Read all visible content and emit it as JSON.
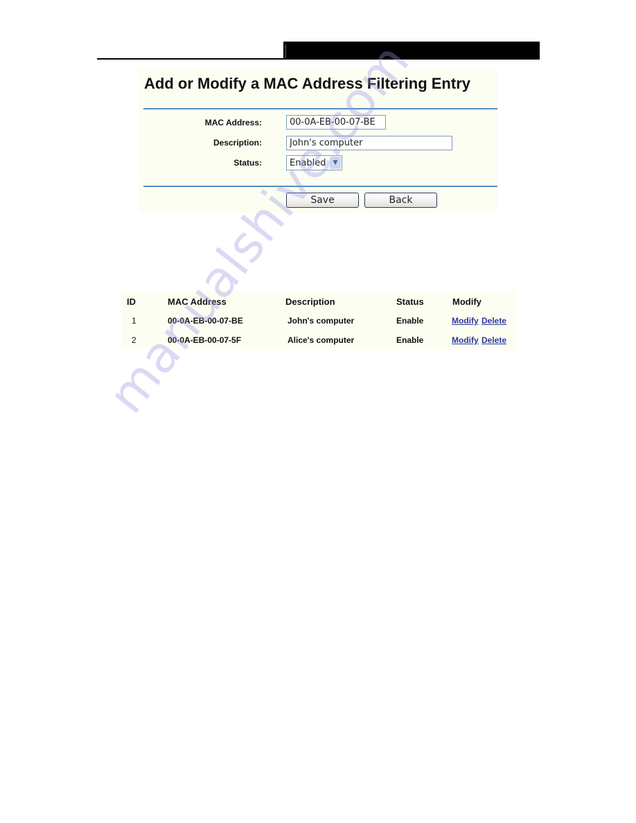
{
  "form": {
    "title": "Add or Modify a MAC Address Filtering Entry",
    "mac_label": "MAC Address:",
    "mac_value": "00-0A-EB-00-07-BE",
    "desc_label": "Description:",
    "desc_value": "John's computer",
    "status_label": "Status:",
    "status_value": "Enabled",
    "save_label": "Save",
    "back_label": "Back"
  },
  "table": {
    "headers": [
      "ID",
      "MAC Address",
      "Description",
      "Status",
      "Modify"
    ],
    "rows": [
      {
        "id": "1",
        "mac": "00-0A-EB-00-07-BE",
        "description": "John's computer",
        "status": "Enable",
        "modify": "Modify",
        "delete": "Delete"
      },
      {
        "id": "2",
        "mac": "00-0A-EB-00-07-5F",
        "description": "Alice's computer",
        "status": "Enable",
        "modify": "Modify",
        "delete": "Delete"
      }
    ]
  },
  "watermark": "manualshive.com",
  "colors": {
    "panel_bg": "#fdfef2",
    "rule": "#4f8fc4",
    "link": "#2b3aa0"
  }
}
